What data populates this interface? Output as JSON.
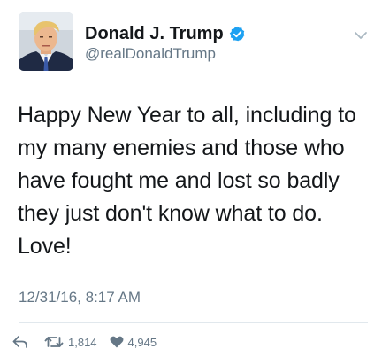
{
  "user": {
    "display_name": "Donald J. Trump",
    "handle": "@realDonaldTrump",
    "verified": true,
    "avatar_icon": "profile-photo"
  },
  "tweet": {
    "text": "Happy New Year to all, including to my many enemies and those who have fought me and lost so badly they just don't know what to do. Love!",
    "timestamp": "12/31/16, 8:17 AM"
  },
  "actions": {
    "reply_icon": "reply-icon",
    "retweet_icon": "retweet-icon",
    "retweet_count": "1,814",
    "like_icon": "heart-icon",
    "like_count": "4,945"
  },
  "colors": {
    "text": "#14171a",
    "secondary": "#657786",
    "verified": "#1da1f2",
    "divider": "#e1e8ed"
  }
}
